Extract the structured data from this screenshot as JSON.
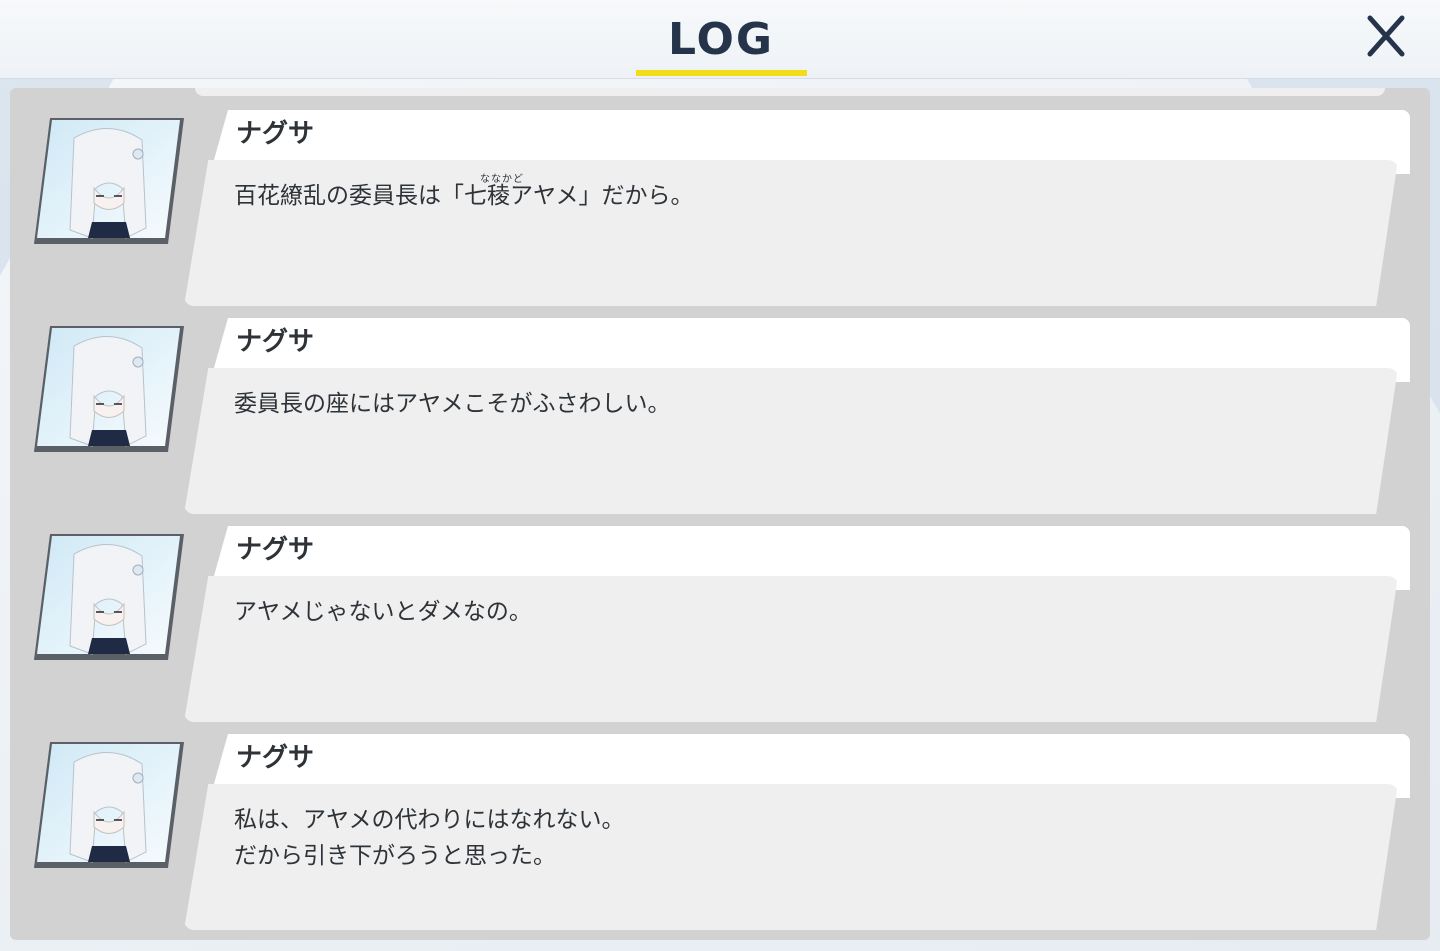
{
  "header": {
    "title": "LOG",
    "close_icon": "close-icon",
    "accent_color": "#f2dd1a"
  },
  "entries": [
    {
      "speaker": "ナグサ",
      "text": "百花繚乱の委員長は「七稜アヤメ」だから。",
      "ruby": "ななかど",
      "avatar_icon": "character-portrait"
    },
    {
      "speaker": "ナグサ",
      "text": "委員長の座にはアヤメこそがふさわしい。",
      "avatar_icon": "character-portrait"
    },
    {
      "speaker": "ナグサ",
      "text": "アヤメじゃないとダメなの。",
      "avatar_icon": "character-portrait"
    },
    {
      "speaker": "ナグサ",
      "text": "私は、アヤメの代わりにはなれない。\nだから引き下がろうと思った。",
      "avatar_icon": "character-portrait"
    }
  ]
}
